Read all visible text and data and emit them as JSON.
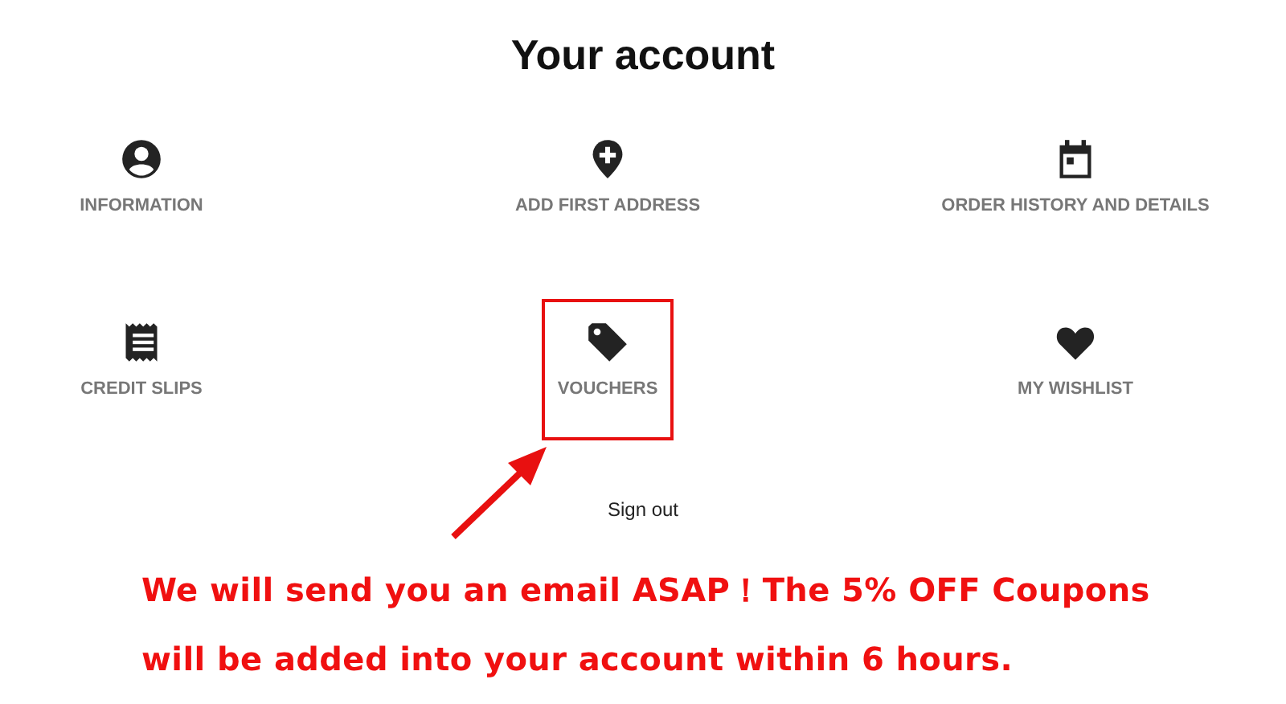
{
  "title": "Your account",
  "links": [
    {
      "label": "INFORMATION",
      "kind": "person",
      "highlighted": false
    },
    {
      "label": "ADD FIRST ADDRESS",
      "kind": "pin-plus",
      "highlighted": false
    },
    {
      "label": "ORDER HISTORY AND DETAILS",
      "kind": "calendar",
      "highlighted": false
    },
    {
      "label": "CREDIT SLIPS",
      "kind": "receipt",
      "highlighted": false
    },
    {
      "label": "VOUCHERS",
      "kind": "tag",
      "highlighted": true
    },
    {
      "label": "MY WISHLIST",
      "kind": "heart",
      "highlighted": false
    }
  ],
  "sign_out": "Sign out",
  "annotation": {
    "lines": [
      "We will send you an email ASAP！The 5% OFF Coupons",
      "will be added into your account within 6 hours."
    ]
  }
}
